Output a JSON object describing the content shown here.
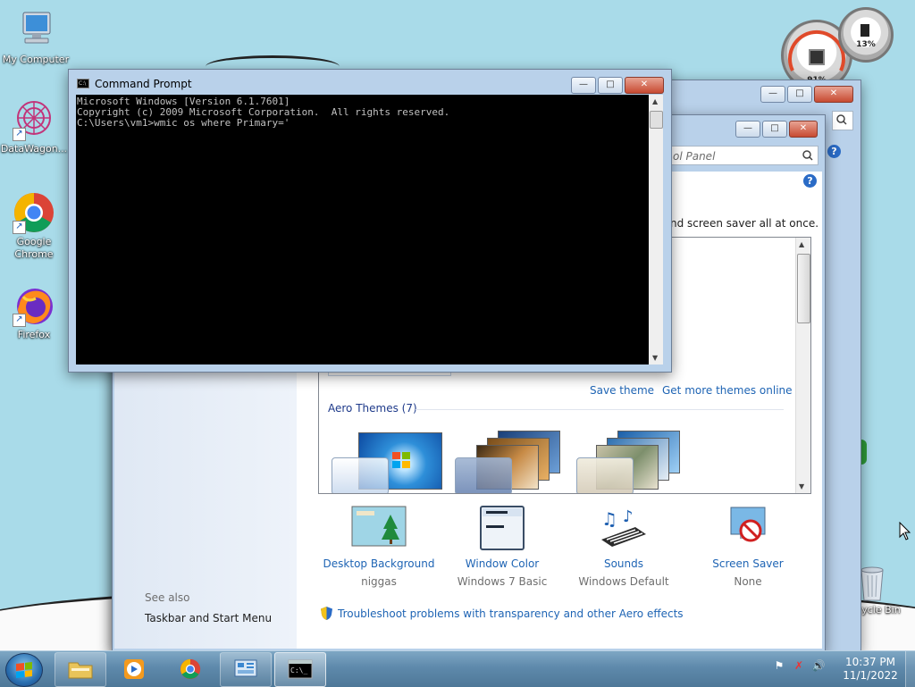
{
  "desktop": {
    "icons": [
      {
        "label": "My Computer",
        "icon": "computer-icon"
      },
      {
        "label": "DataWagon...",
        "icon": "datawagon-icon"
      },
      {
        "label": "Google Chrome",
        "icon": "chrome-icon"
      },
      {
        "label": "Firefox",
        "icon": "firefox-icon"
      },
      {
        "label": "Recycle Bin",
        "icon": "recycle-bin-icon"
      }
    ],
    "gadget": {
      "cpu": "91%",
      "ram": "13%"
    }
  },
  "cmd": {
    "title": "Command Prompt",
    "lines": [
      "Microsoft Windows [Version 6.1.7601]",
      "Copyright (c) 2009 Microsoft Corporation.  All rights reserved.",
      "",
      "C:\\Users\\vm1>wmic os where Primary='"
    ]
  },
  "personalization": {
    "search_placeholder": "ol Panel",
    "description": "nd screen saver all at once.",
    "save_theme": "Save theme",
    "get_more_themes": "Get more themes online",
    "aero_header": "Aero Themes (7)",
    "see_also": "See also",
    "taskbar_link": "Taskbar and Start Menu",
    "bottom_items": [
      {
        "label": "Desktop Background",
        "sub": "niggas"
      },
      {
        "label": "Window Color",
        "sub": "Windows 7 Basic"
      },
      {
        "label": "Sounds",
        "sub": "Windows Default"
      },
      {
        "label": "Screen Saver",
        "sub": "None"
      }
    ],
    "troubleshoot": "Troubleshoot problems with transparency and other Aero effects"
  },
  "taskbar": {
    "buttons": [
      "file-explorer-icon",
      "media-player-icon",
      "chrome-icon",
      "control-panel-icon",
      "command-prompt-icon"
    ],
    "active": "command-prompt-icon"
  },
  "clock": {
    "time": "10:37 PM",
    "date": "11/1/2022"
  },
  "colors": {
    "accent": "#1e64b4",
    "console_bg": "#000000",
    "console_text": "#c0c0c0"
  }
}
